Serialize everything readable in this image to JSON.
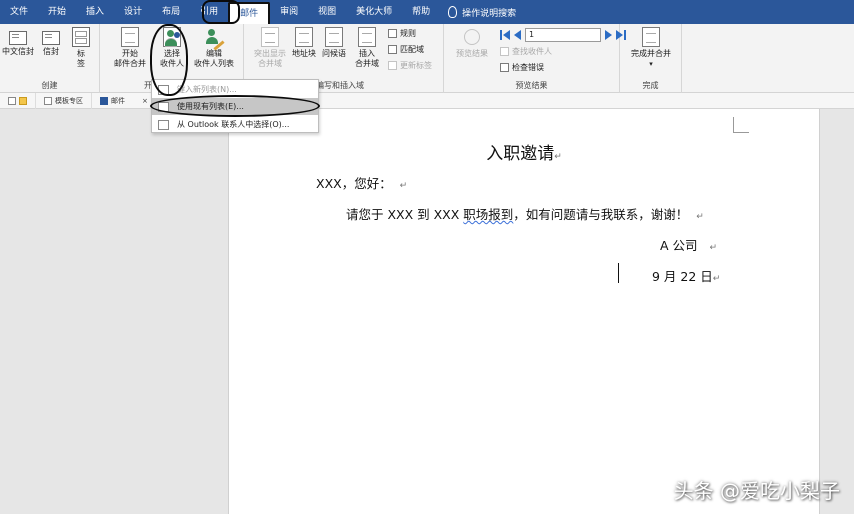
{
  "menubar": {
    "tabs": [
      "文件",
      "开始",
      "插入",
      "设计",
      "布局",
      "引用",
      "邮件",
      "审阅",
      "视图",
      "美化大师",
      "帮助"
    ],
    "active_tab": "邮件",
    "search": "操作说明搜索"
  },
  "ribbon": {
    "create": {
      "label": "创建",
      "chinese_envelope": "中文信封",
      "envelope": "信封",
      "labels_line1": "标",
      "labels_line2": "签"
    },
    "start_merge": {
      "label": "开",
      "start_line1": "开始",
      "start_line2": "邮件合并",
      "select_line1": "选择",
      "select_line2": "收件人",
      "edit_line1": "编辑",
      "edit_line2": "收件人列表"
    },
    "write_insert": {
      "label": "编写和插入域",
      "highlight_line1": "突出显示",
      "highlight_line2": "合并域",
      "address_block": "地址块",
      "greeting_line": "问候语",
      "insert_line1": "插入",
      "insert_line2": "合并域",
      "rules": "规则",
      "match_fields": "匹配域",
      "update_labels": "更新标签"
    },
    "preview": {
      "label": "预览结果",
      "preview_results": "预览结果",
      "record_value": "1",
      "find_recipient": "查找收件人",
      "check_errors": "检查错误"
    },
    "finish": {
      "label": "完成",
      "finish_merge": "完成并合并"
    }
  },
  "tabstrip": {
    "template_zone": "模板专区",
    "mail": "邮件"
  },
  "dropdown": {
    "items": [
      "键入新列表(N)...",
      "使用现有列表(E)...",
      "从 Outlook 联系人中选择(O)..."
    ]
  },
  "document": {
    "title": "入职邀请",
    "greeting": "XXX，您好：",
    "body_prefix": "请您于 XXX 到 XXX ",
    "body_wavy": "职场报到",
    "body_suffix": "，如有问题请与我联系，谢谢！",
    "company": "A 公司",
    "date": "9 月 22 日",
    "para_mark": "↵"
  },
  "watermark": "头条 @爱吃小梨子"
}
